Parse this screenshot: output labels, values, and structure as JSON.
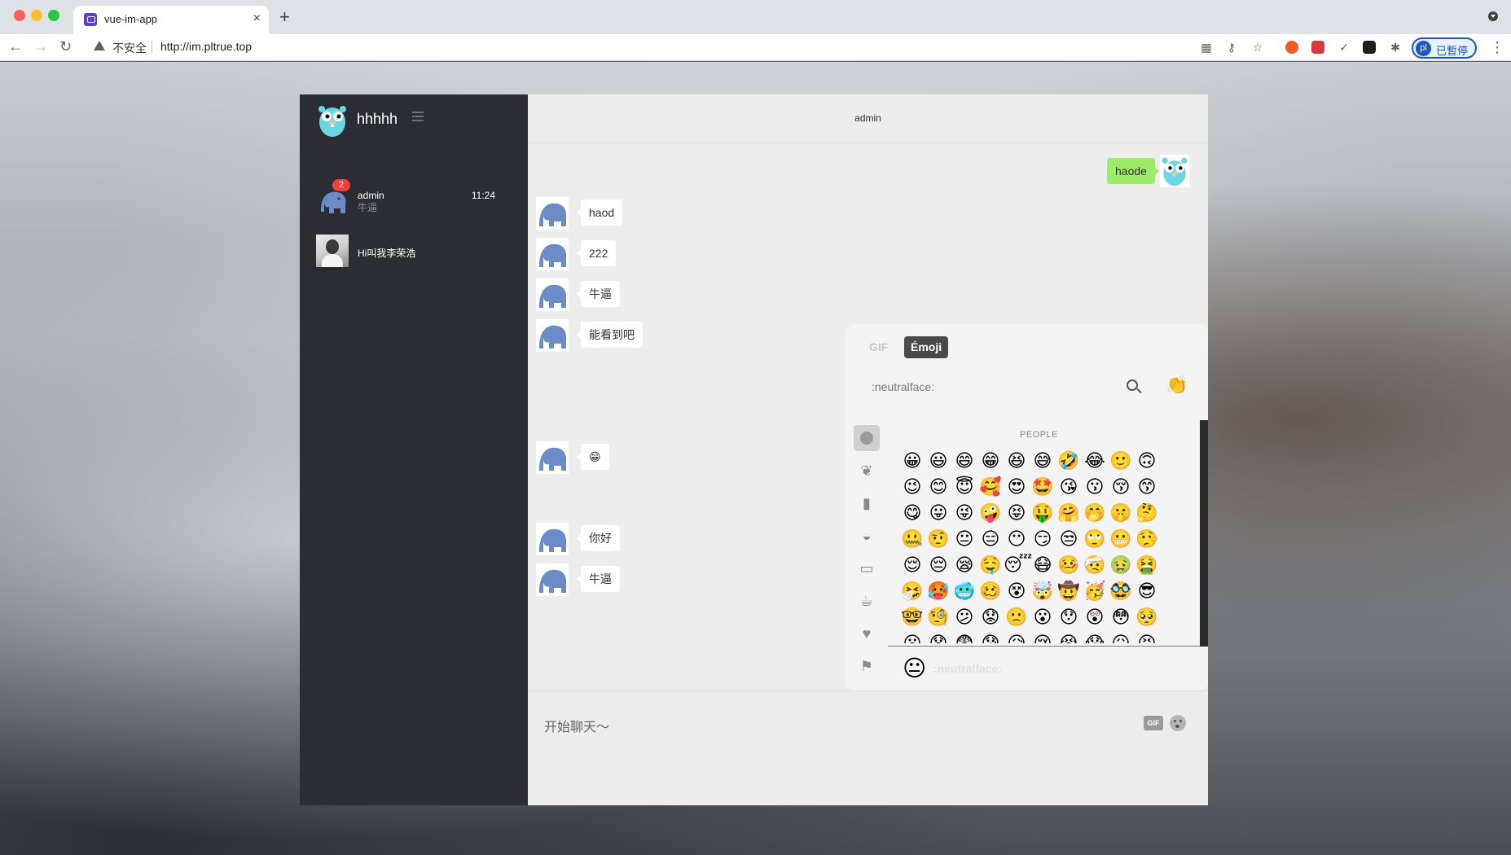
{
  "browser": {
    "tab_title": "vue-im-app",
    "tab_close": "×",
    "new_tab": "+",
    "insecure_label": "不安全",
    "url": "http://im.pltrue.top",
    "profile_initials": "pl",
    "profile_status": "已暫停",
    "nav_back": "←",
    "nav_forward": "→",
    "nav_reload": "↻",
    "menu": "⋮",
    "toolbar_icons": [
      "qr-code-icon",
      "key-icon",
      "star-icon",
      "puzzle-extension-icon"
    ],
    "extension_colors": [
      "#f25c22",
      "#d93a3a",
      "#5a5a5a",
      "#1e1e1e"
    ]
  },
  "sidebar": {
    "username": "hhhhh",
    "contacts": [
      {
        "name": "admin",
        "last_message": "牛逼",
        "time": "11:24",
        "unread": "2"
      },
      {
        "name": "Hi叫我李荣浩",
        "last_message": "",
        "time": "",
        "unread": ""
      }
    ]
  },
  "chat": {
    "title": "admin",
    "my_messages": [
      {
        "text": "haode"
      }
    ],
    "messages": [
      {
        "text": "haod"
      },
      {
        "text": "222"
      },
      {
        "text": "牛逼"
      },
      {
        "text": "能看到吧"
      },
      {
        "text": "😁"
      },
      {
        "text": "你好"
      },
      {
        "text": "牛逼"
      }
    ],
    "input_placeholder": "开始聊天～",
    "gif_button": "GIF"
  },
  "emoji_picker": {
    "tab_gif": "GIF",
    "tab_emoji": "Émoji",
    "search_placeholder": ":neutralface:",
    "category_label": "PEOPLE",
    "skin_tone_emoji": "👏",
    "preview_emoji": "😐",
    "preview_name": ":neutralface:",
    "categories": [
      "smiley-icon",
      "leaf-icon",
      "food-icon",
      "ball-icon",
      "car-icon",
      "object-icon",
      "heart-icon",
      "flag-icon"
    ],
    "emojis": [
      "😀",
      "😃",
      "😄",
      "😁",
      "😆",
      "😅",
      "🤣",
      "😂",
      "🙂",
      "🙃",
      "😉",
      "😊",
      "😇",
      "🥰",
      "😍",
      "🤩",
      "😘",
      "😗",
      "😚",
      "😙",
      "😋",
      "😛",
      "😜",
      "🤪",
      "😝",
      "🤑",
      "🤗",
      "🤭",
      "🤫",
      "🤔",
      "🤐",
      "🤨",
      "😐",
      "😑",
      "😶",
      "😏",
      "😒",
      "🙄",
      "😬",
      "🤥",
      "😌",
      "😔",
      "😪",
      "🤤",
      "😴",
      "😷",
      "🤒",
      "🤕",
      "🤢",
      "🤮",
      "🤧",
      "🥵",
      "🥶",
      "🥴",
      "😵",
      "🤯",
      "🤠",
      "🥳",
      "🥸",
      "😎",
      "🤓",
      "🧐",
      "😕",
      "😟",
      "🙁",
      "😮",
      "😯",
      "😲",
      "😳",
      "🥺",
      "😦",
      "😧",
      "😨",
      "😰",
      "😥",
      "😢",
      "😭",
      "😱",
      "😖",
      "😣",
      "😞",
      "😓",
      "😩",
      "😫",
      "🥱",
      "😤",
      "😡",
      "😠",
      "🤬",
      "😈"
    ]
  }
}
